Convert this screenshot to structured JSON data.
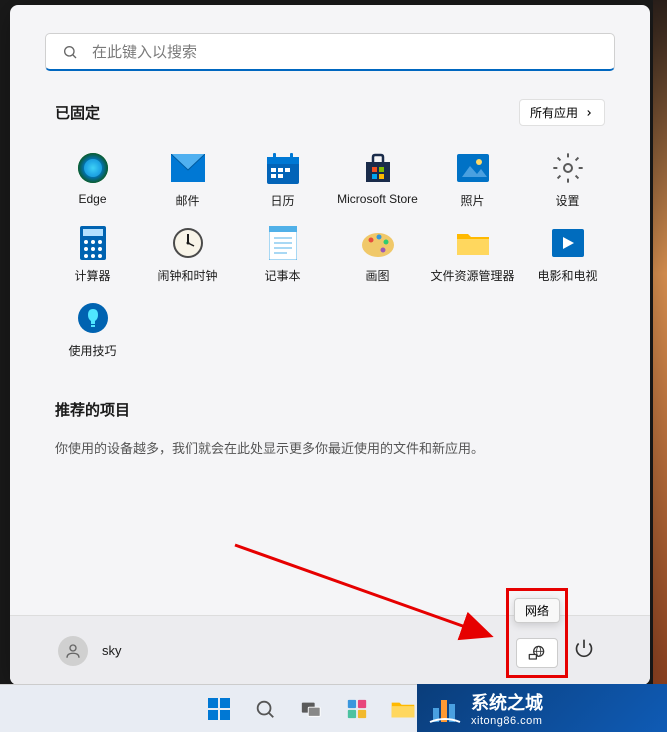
{
  "search": {
    "placeholder": "在此键入以搜索"
  },
  "pinned": {
    "title": "已固定",
    "allAppsLabel": "所有应用",
    "apps": [
      {
        "label": "Edge"
      },
      {
        "label": "邮件"
      },
      {
        "label": "日历"
      },
      {
        "label": "Microsoft Store"
      },
      {
        "label": "照片"
      },
      {
        "label": "设置"
      },
      {
        "label": "计算器"
      },
      {
        "label": "闹钟和时钟"
      },
      {
        "label": "记事本"
      },
      {
        "label": "画图"
      },
      {
        "label": "文件资源管理器"
      },
      {
        "label": "电影和电视"
      },
      {
        "label": "使用技巧"
      }
    ]
  },
  "recommended": {
    "title": "推荐的项目",
    "emptyText": "你使用的设备越多，我们就会在此处显示更多你最近使用的文件和新应用。"
  },
  "user": {
    "name": "sky"
  },
  "tooltip": {
    "network": "网络"
  },
  "watermark": {
    "title": "系统之城",
    "url": "xitong86.com"
  }
}
